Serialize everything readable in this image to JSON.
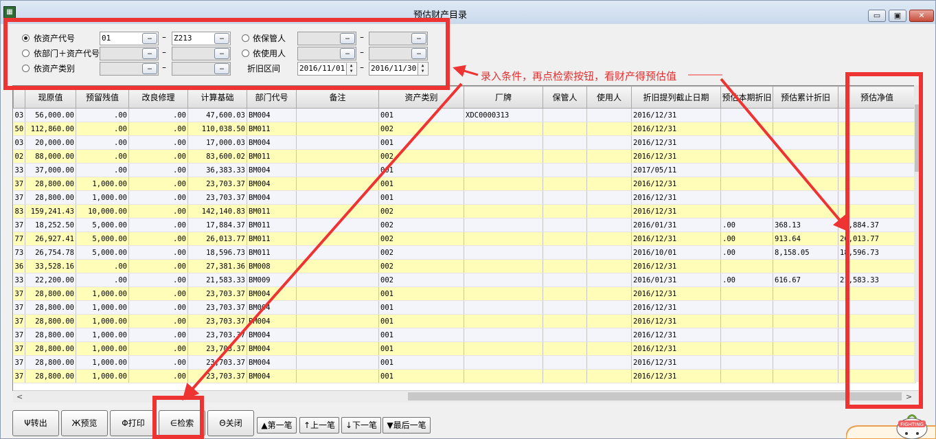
{
  "window": {
    "title": "预估财产目录",
    "minimize": "▭",
    "maximize": "▣",
    "close": "✕"
  },
  "filters": {
    "by_code": {
      "label": "依资产代号",
      "from": "01",
      "to": "Z213",
      "selected": true
    },
    "by_dept": {
      "label": "依部门＋资产代号",
      "from": "",
      "to": "",
      "selected": false
    },
    "by_category": {
      "label": "依资产类别",
      "from": "",
      "to": "",
      "selected": false
    },
    "by_custodian": {
      "label": "依保管人",
      "from": "",
      "to": "",
      "selected": false
    },
    "by_user": {
      "label": "依使用人",
      "from": "",
      "to": "",
      "selected": false
    },
    "depreciation_period": {
      "label": "折旧区间",
      "from": "2016/11/01",
      "to": "2016/11/30"
    },
    "ellipsis": "…",
    "dash": "–",
    "spin_up": "▲",
    "spin_down": "▼"
  },
  "annotation": {
    "note": "录入条件，再点检索按钮，看财产得预估值",
    "color": "#e53030"
  },
  "table": {
    "columns": [
      "",
      "现原值",
      "预留残值",
      "改良修理",
      "计算基础",
      "部门代号",
      "备注",
      "资产类别",
      "厂牌",
      "保管人",
      "使用人",
      "折旧提列截止日期",
      "预估本期折旧",
      "预估累计折旧",
      "预估净值"
    ],
    "rows": [
      [
        "03",
        "56,000.00",
        ".00",
        ".00",
        "47,600.03",
        "BM004",
        "",
        "001",
        "XDC0000313",
        "",
        "",
        "2016/12/31",
        "",
        "",
        ""
      ],
      [
        "50",
        "112,860.00",
        ".00",
        ".00",
        "110,038.50",
        "BM011",
        "",
        "002",
        "",
        "",
        "",
        "2016/12/31",
        "",
        "",
        ""
      ],
      [
        "03",
        "20,000.00",
        ".00",
        ".00",
        "17,000.03",
        "BM004",
        "",
        "001",
        "",
        "",
        "",
        "2016/12/31",
        "",
        "",
        ""
      ],
      [
        "02",
        "88,000.00",
        ".00",
        ".00",
        "83,600.02",
        "BM011",
        "",
        "002",
        "",
        "",
        "",
        "2016/12/31",
        "",
        "",
        ""
      ],
      [
        "33",
        "37,000.00",
        ".00",
        ".00",
        "36,383.33",
        "BM004",
        "",
        "001",
        "",
        "",
        "",
        "2017/05/11",
        "",
        "",
        ""
      ],
      [
        "37",
        "28,800.00",
        "1,000.00",
        ".00",
        "23,703.37",
        "BM004",
        "",
        "001",
        "",
        "",
        "",
        "2016/12/31",
        "",
        "",
        ""
      ],
      [
        "37",
        "28,800.00",
        "1,000.00",
        ".00",
        "23,703.37",
        "BM004",
        "",
        "001",
        "",
        "",
        "",
        "2016/12/31",
        "",
        "",
        ""
      ],
      [
        "83",
        "159,241.43",
        "10,000.00",
        ".00",
        "142,140.83",
        "BM011",
        "",
        "002",
        "",
        "",
        "",
        "2016/12/31",
        "",
        "",
        ""
      ],
      [
        "37",
        "18,252.50",
        "5,000.00",
        ".00",
        "17,884.37",
        "BM011",
        "",
        "002",
        "",
        "",
        "",
        "2016/01/31",
        ".00",
        "368.13",
        "17,884.37"
      ],
      [
        "77",
        "26,927.41",
        "5,000.00",
        ".00",
        "26,013.77",
        "BM011",
        "",
        "002",
        "",
        "",
        "",
        "2016/12/31",
        ".00",
        "913.64",
        "26,013.77"
      ],
      [
        "73",
        "26,754.78",
        "5,000.00",
        ".00",
        "18,596.73",
        "BM011",
        "",
        "002",
        "",
        "",
        "",
        "2016/10/01",
        ".00",
        "8,158.05",
        "18,596.73"
      ],
      [
        "36",
        "33,528.16",
        ".00",
        ".00",
        "27,381.36",
        "BM008",
        "",
        "002",
        "",
        "",
        "",
        "2016/12/31",
        "",
        "",
        ""
      ],
      [
        "33",
        "22,200.00",
        ".00",
        ".00",
        "21,583.33",
        "BM009",
        "",
        "002",
        "",
        "",
        "",
        "2016/01/31",
        ".00",
        "616.67",
        "21,583.33"
      ],
      [
        "37",
        "28,800.00",
        "1,000.00",
        ".00",
        "23,703.37",
        "BM004",
        "",
        "001",
        "",
        "",
        "",
        "2016/12/31",
        "",
        "",
        ""
      ],
      [
        "37",
        "28,800.00",
        "1,000.00",
        ".00",
        "23,703.37",
        "BM004",
        "",
        "001",
        "",
        "",
        "",
        "2016/12/31",
        "",
        "",
        ""
      ],
      [
        "37",
        "28,800.00",
        "1,000.00",
        ".00",
        "23,703.37",
        "BM004",
        "",
        "001",
        "",
        "",
        "",
        "2016/12/31",
        "",
        "",
        ""
      ],
      [
        "37",
        "28,800.00",
        "1,000.00",
        ".00",
        "23,703.37",
        "BM004",
        "",
        "001",
        "",
        "",
        "",
        "2016/12/31",
        "",
        "",
        ""
      ],
      [
        "37",
        "28,800.00",
        "1,000.00",
        ".00",
        "23,703.37",
        "BM004",
        "",
        "001",
        "",
        "",
        "",
        "2016/12/31",
        "",
        "",
        ""
      ],
      [
        "37",
        "28,800.00",
        "1,000.00",
        ".00",
        "23,703.37",
        "BM004",
        "",
        "001",
        "",
        "",
        "",
        "2016/12/31",
        "",
        "",
        ""
      ],
      [
        "37",
        "28,800.00",
        "1,000.00",
        ".00",
        "23,703.37",
        "BM004",
        "",
        "001",
        "",
        "",
        "",
        "2016/12/31",
        "",
        "",
        ""
      ]
    ]
  },
  "scrollbar": {
    "left_arrow": "<",
    "right_arrow": ">"
  },
  "buttons": {
    "export": "Ψ转出",
    "preview": "Ж预览",
    "print": "Φ打印",
    "search": "∈检索",
    "close": "Θ关闭"
  },
  "nav": {
    "first": "▲第一笔",
    "prev": "↑上一笔",
    "next": "↓下一笔",
    "last": "▼最后一笔"
  },
  "mascot": {
    "text": "FIGHTING",
    "icon": "fighting-mascot-icon"
  }
}
